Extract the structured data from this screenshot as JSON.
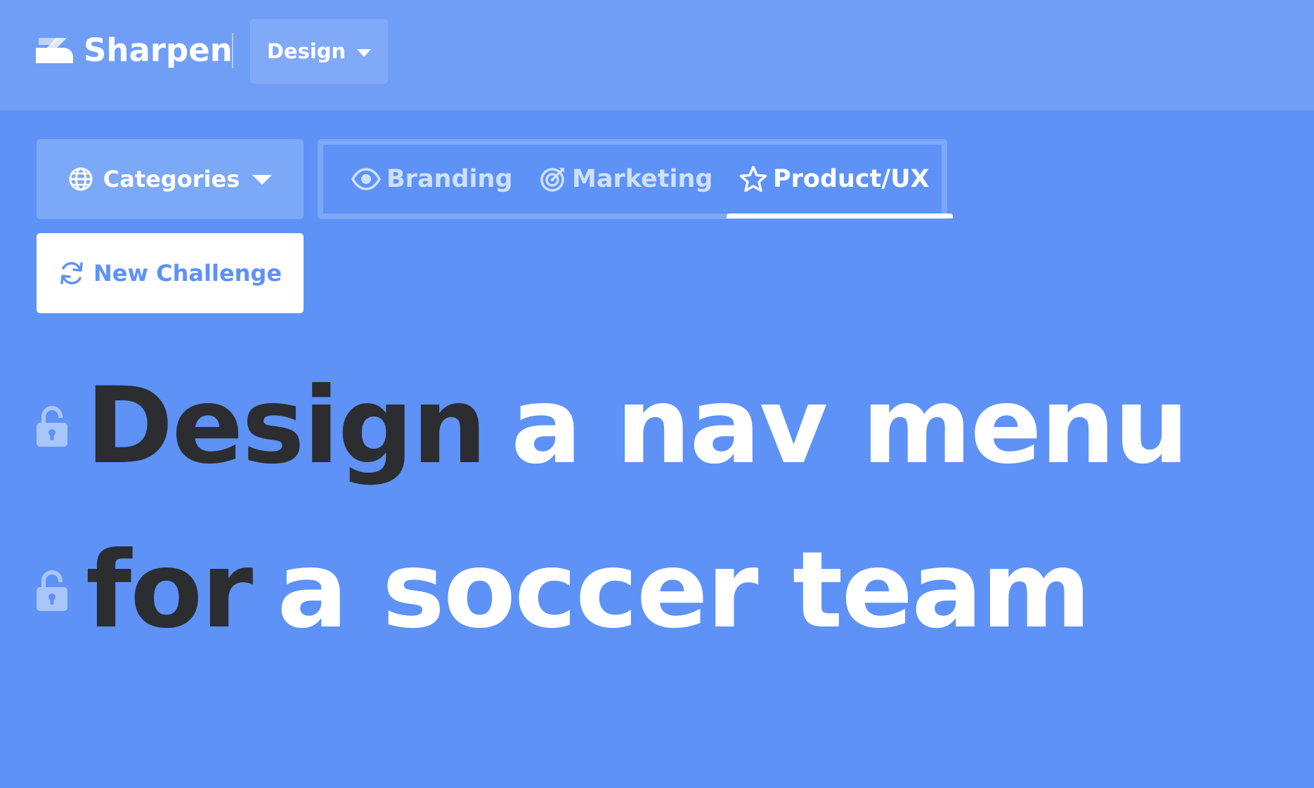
{
  "header": {
    "brand_name": "Sharpen",
    "logo_icon": "sharpen-logo-icon",
    "mode_dropdown_label": "Design",
    "mode_dropdown_icon": "chevron-down-icon"
  },
  "filters": {
    "categories_label": "Categories",
    "categories_icon": "globe-icon",
    "tabs": [
      {
        "label": "Branding",
        "icon": "eye-icon",
        "active": false
      },
      {
        "label": "Marketing",
        "icon": "target-icon",
        "active": false
      },
      {
        "label": "Product/UX",
        "icon": "star-icon",
        "active": true
      }
    ]
  },
  "actions": {
    "new_challenge_label": "New Challenge",
    "new_challenge_icon": "refresh-icon"
  },
  "challenge": {
    "line1_verb": "Design",
    "line1_object": "a nav menu",
    "line2_prep": "for",
    "line2_target": "a soccer team",
    "lock_icon": "unlocked-padlock-icon"
  },
  "colors": {
    "background": "#5e92f6",
    "header_bg": "#709ef7",
    "accent_dark": "#2b2d31",
    "white": "#ffffff"
  }
}
